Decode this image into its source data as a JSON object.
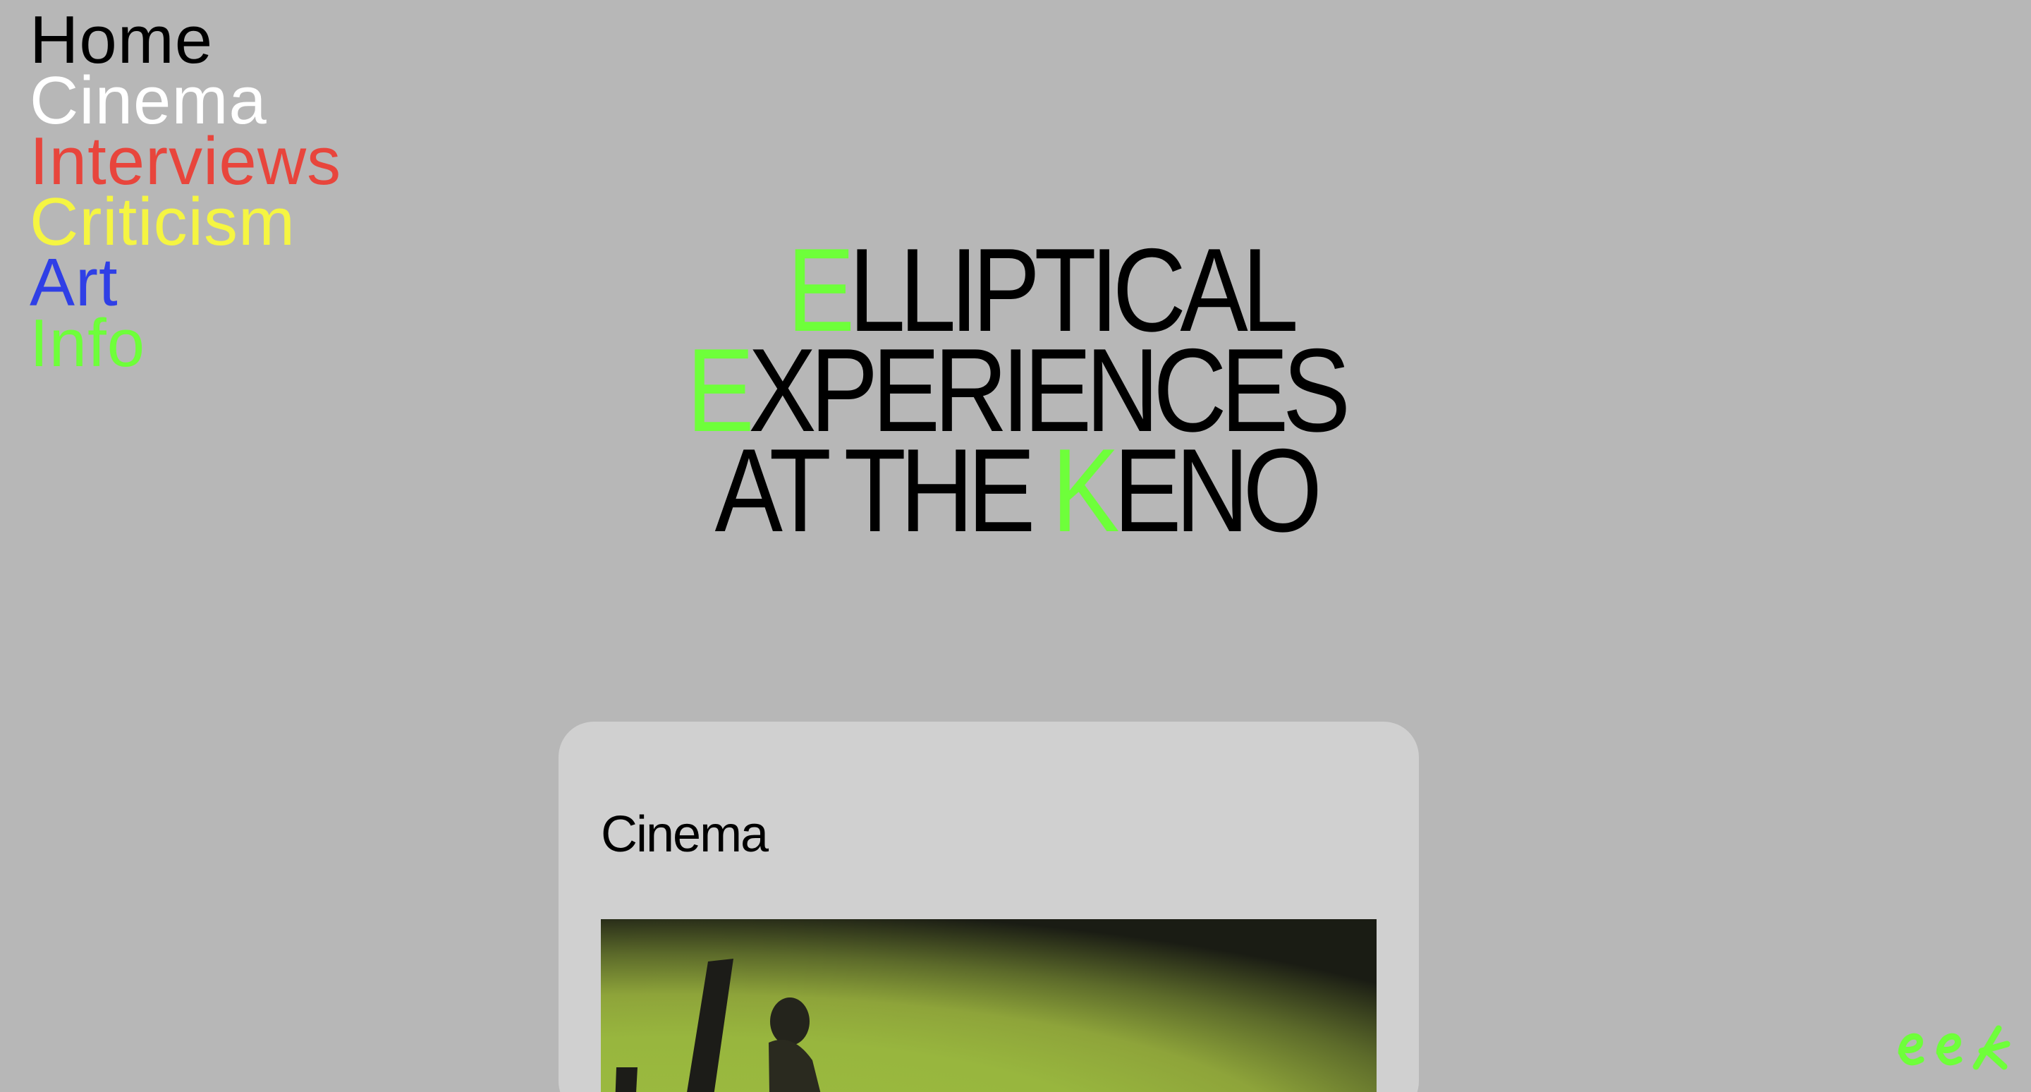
{
  "nav": {
    "items": [
      {
        "label": "Home",
        "color": "#000000"
      },
      {
        "label": "Cinema",
        "color": "#ffffff"
      },
      {
        "label": "Interviews",
        "color": "#e8453c"
      },
      {
        "label": "Criticism",
        "color": "#f5f542"
      },
      {
        "label": "Art",
        "color": "#2f3fe6"
      },
      {
        "label": "Info",
        "color": "#6eff3a"
      }
    ]
  },
  "hero": {
    "line1": {
      "initial": "E",
      "rest": "LLIPTICAL"
    },
    "line2": {
      "initial": "E",
      "rest": "XPERIENCES"
    },
    "line3": {
      "before": "AT THE ",
      "initial": "K",
      "rest": "ENO"
    },
    "accent_color": "#6eff3a"
  },
  "card": {
    "title": "Cinema",
    "image_icon": "film-still-image"
  },
  "corner_logo": {
    "icon": "eek-logo-icon",
    "color": "#6eff3a"
  },
  "colors": {
    "background": "#b7b7b7",
    "card_background": "#d0d0d0"
  }
}
